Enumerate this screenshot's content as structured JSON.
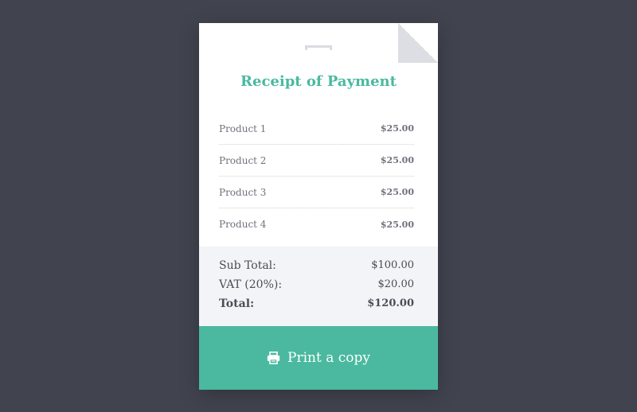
{
  "receipt": {
    "title": "Receipt of Payment",
    "items": [
      {
        "name": "Product 1",
        "price": "$25.00"
      },
      {
        "name": "Product 2",
        "price": "$25.00"
      },
      {
        "name": "Product 3",
        "price": "$25.00"
      },
      {
        "name": "Product 4",
        "price": "$25.00"
      }
    ],
    "totals": {
      "subtotal_label": "Sub Total:",
      "subtotal_value": "$100.00",
      "vat_label": "VAT (20%):",
      "vat_value": "$20.00",
      "total_label": "Total:",
      "total_value": "$120.00"
    },
    "print_button": {
      "label": "Print a copy",
      "icon": "printer-icon"
    }
  },
  "colors": {
    "background": "#41444f",
    "accent": "#4ab99f",
    "card": "#ffffff",
    "totals_bg": "#f3f4f7"
  }
}
